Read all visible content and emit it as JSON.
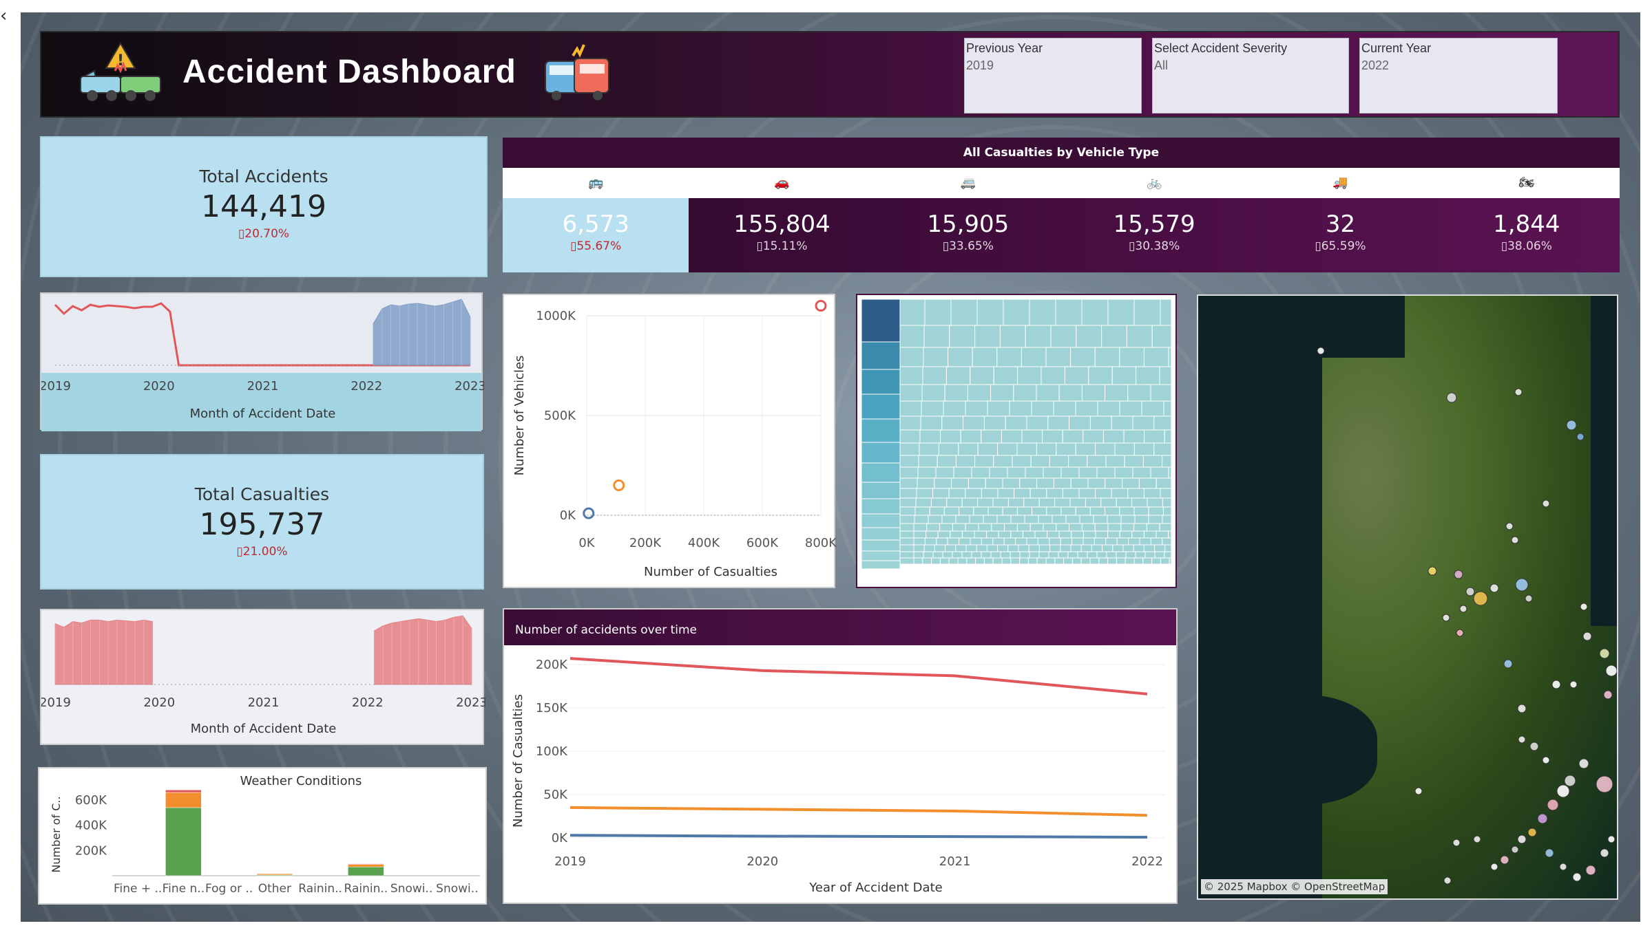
{
  "back_icon": "chevron-left-icon",
  "header": {
    "title": "Accident Dashboard",
    "logo_icon": "car-crash-warning-icon",
    "logo2_icon": "bus-crash-icon",
    "filters": [
      {
        "label": "Previous Year",
        "value": "2019"
      },
      {
        "label": "Select Accident Severity",
        "value": "All"
      },
      {
        "label": "Current Year",
        "value": "2022"
      }
    ]
  },
  "kpis": {
    "accidents": {
      "label": "Total Accidents",
      "value": "144,419",
      "change": "20.70%"
    },
    "casualties": {
      "label": "Total Casualties",
      "value": "195,737",
      "change": "21.00%"
    }
  },
  "vehicles": {
    "title": "All Casualties by Vehicle Type",
    "items": [
      {
        "icon": "bus-icon",
        "value": "6,573",
        "change": "55.67%"
      },
      {
        "icon": "car-icon",
        "value": "155,804",
        "change": "15.11%"
      },
      {
        "icon": "van-icon",
        "value": "15,905",
        "change": "33.65%"
      },
      {
        "icon": "bicycle-icon",
        "value": "15,579",
        "change": "30.38%"
      },
      {
        "icon": "truck-icon",
        "value": "32",
        "change": "65.59%"
      },
      {
        "icon": "motorcycle-icon",
        "value": "1,844",
        "change": "38.06%"
      }
    ]
  },
  "colors": {
    "red": "#e15759",
    "blue": "#4e79a7",
    "orange": "#f28e2b",
    "green": "#59a14f",
    "accent": "#4d0f45"
  },
  "chart_data": [
    {
      "type": "area",
      "xlabel": "Month of Accident Date",
      "tick_labels": [
        "2019",
        "2020",
        "2021",
        "2022",
        "2023"
      ],
      "series": [
        {
          "name": "",
          "kind": "line",
          "color": "#e15759",
          "values": [
            88,
            75,
            86,
            80,
            88,
            85,
            87,
            86,
            85,
            83,
            85,
            85,
            90,
            78,
            0,
            0,
            0,
            0,
            0,
            0,
            0,
            0,
            0,
            0,
            0,
            0,
            0,
            0,
            0,
            0,
            0,
            0,
            0,
            0,
            0,
            0,
            0,
            0,
            0,
            0,
            0,
            0,
            0,
            0,
            0,
            0,
            0,
            0
          ]
        },
        {
          "name": "",
          "kind": "area",
          "color": "#7f9fc7",
          "values": [
            0,
            0,
            0,
            0,
            0,
            0,
            0,
            0,
            0,
            0,
            0,
            0,
            0,
            0,
            0,
            0,
            0,
            0,
            0,
            0,
            0,
            0,
            0,
            0,
            0,
            0,
            0,
            0,
            0,
            0,
            0,
            0,
            0,
            0,
            0,
            0,
            60,
            82,
            88,
            86,
            89,
            90,
            88,
            86,
            88,
            92,
            96,
            70
          ]
        }
      ]
    },
    {
      "type": "scatter",
      "xlabel": "Number of Casualties",
      "ylabel": "Number of Vehicles",
      "xticks": [
        "0K",
        "200K",
        "400K",
        "600K",
        "800K"
      ],
      "yticks": [
        "0K",
        "500K",
        "1000K"
      ],
      "xlim": [
        0,
        800000
      ],
      "ylim": [
        0,
        1000000
      ],
      "points": [
        {
          "x": 6573,
          "y": 10000,
          "color": "#4e79a7"
        },
        {
          "x": 110000,
          "y": 150000,
          "color": "#f28e2b"
        },
        {
          "x": 800000,
          "y": 1050000,
          "color": "#e15759"
        }
      ]
    },
    {
      "type": "area",
      "xlabel": "Month of Accident Date",
      "tick_labels": [
        "2019",
        "2020",
        "2021",
        "2022",
        "2023"
      ],
      "series": [
        {
          "name": "",
          "kind": "area",
          "color": "#e57f82",
          "values": [
            85,
            80,
            88,
            86,
            90,
            90,
            88,
            90,
            89,
            88,
            90,
            88,
            0,
            0,
            0,
            0,
            0,
            0,
            0,
            0,
            0,
            0,
            0,
            0,
            0,
            0,
            0,
            0,
            0,
            0,
            0,
            0,
            0,
            0,
            0,
            0,
            75,
            82,
            86,
            88,
            90,
            92,
            90,
            88,
            90,
            94,
            96,
            78
          ]
        }
      ]
    },
    {
      "type": "bar",
      "title": "Weather Conditions",
      "ylabel": "Number of C..",
      "categories": [
        "Fine + ..",
        "Fine n..",
        "Fog or ..",
        "Other",
        "Rainin..",
        "Rainin..",
        "Snowi..",
        "Snowi.."
      ],
      "yticks": [
        "200K",
        "400K",
        "600K"
      ],
      "ylim": [
        0,
        720000
      ],
      "series": [
        {
          "name": "",
          "color": "#59a14f",
          "values": [
            0,
            540000,
            0,
            6000,
            0,
            70000,
            0,
            0
          ]
        },
        {
          "name": "",
          "color": "#f28e2b",
          "values": [
            0,
            120000,
            0,
            10000,
            0,
            20000,
            0,
            0
          ]
        },
        {
          "name": "",
          "color": "#e15759",
          "values": [
            0,
            20000,
            0,
            2000,
            0,
            5000,
            0,
            0
          ]
        }
      ]
    },
    {
      "type": "line",
      "title": "Number of accidents over time",
      "xlabel": "Year of Accident Date",
      "ylabel": "Number of Casualties",
      "x": [
        "2019",
        "2020",
        "2021",
        "2022"
      ],
      "yticks": [
        "0K",
        "50K",
        "100K",
        "150K",
        "200K"
      ],
      "ylim": [
        0,
        200000
      ],
      "series": [
        {
          "name": "",
          "color": "#e15759",
          "values": [
            207000,
            193000,
            187000,
            166000
          ]
        },
        {
          "name": "",
          "color": "#f28e2b",
          "values": [
            35000,
            33000,
            31000,
            26000
          ]
        },
        {
          "name": "",
          "color": "#4e79a7",
          "values": [
            3000,
            2000,
            1500,
            800
          ]
        }
      ]
    },
    {
      "type": "heatmap",
      "subtype": "treemap",
      "largest_color": "#2b5c8a",
      "base_color": "#9fd3d6"
    }
  ],
  "map": {
    "attribution": "© 2025 Mapbox © OpenStreetMap"
  }
}
